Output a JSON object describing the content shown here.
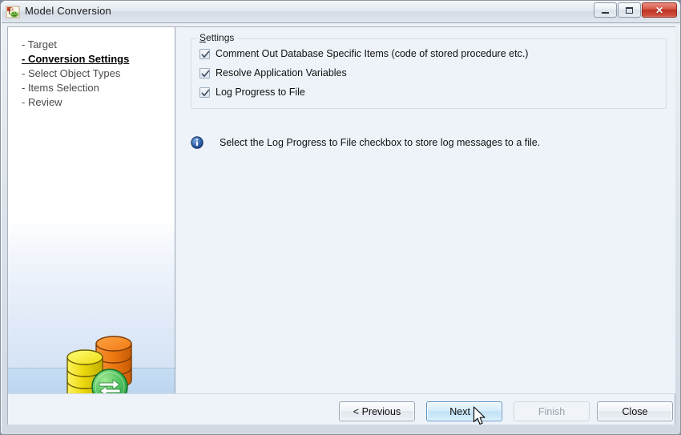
{
  "window": {
    "title": "Model Conversion",
    "icon": "model-conversion-icon",
    "controls": {
      "minimize_label": "Minimize",
      "maximize_label": "Maximize",
      "close_label": "✕"
    }
  },
  "sidebar": {
    "steps": [
      {
        "label": "- Target",
        "active": false
      },
      {
        "label": "- Conversion Settings",
        "active": true
      },
      {
        "label": "- Select Object Types",
        "active": false
      },
      {
        "label": "- Items Selection",
        "active": false
      },
      {
        "label": "- Review",
        "active": false
      }
    ],
    "illustration": "database-conversion-illustration"
  },
  "main": {
    "groupbox": {
      "title": "Settings",
      "title_accelerator": "S",
      "title_rest": "ettings",
      "checkboxes": [
        {
          "label": "Comment Out Database Specific Items (code of stored procedure etc.)",
          "checked": true
        },
        {
          "label": "Resolve Application Variables",
          "checked": true
        },
        {
          "label": "Log Progress to File",
          "checked": true
        }
      ]
    },
    "hint": {
      "icon": "info-icon",
      "text": "Select the Log Progress to File checkbox to store log messages to a file."
    }
  },
  "buttons": {
    "previous": {
      "label": "< Previous",
      "enabled": true
    },
    "next": {
      "label": "Next >",
      "enabled": true,
      "state": "hover"
    },
    "finish": {
      "label": "Finish",
      "enabled": false
    },
    "close": {
      "label": "Close",
      "enabled": true
    }
  },
  "colors": {
    "accent_blue": "#bfe1f7",
    "close_red": "#bf3324",
    "panel_bg": "#eef3fa",
    "sidebar_band": "#c6dcf3",
    "info_blue": "#2b5fa8",
    "db_orange": "#f07c18",
    "db_yellow": "#f2e00c",
    "sync_green": "#3dbb53"
  }
}
